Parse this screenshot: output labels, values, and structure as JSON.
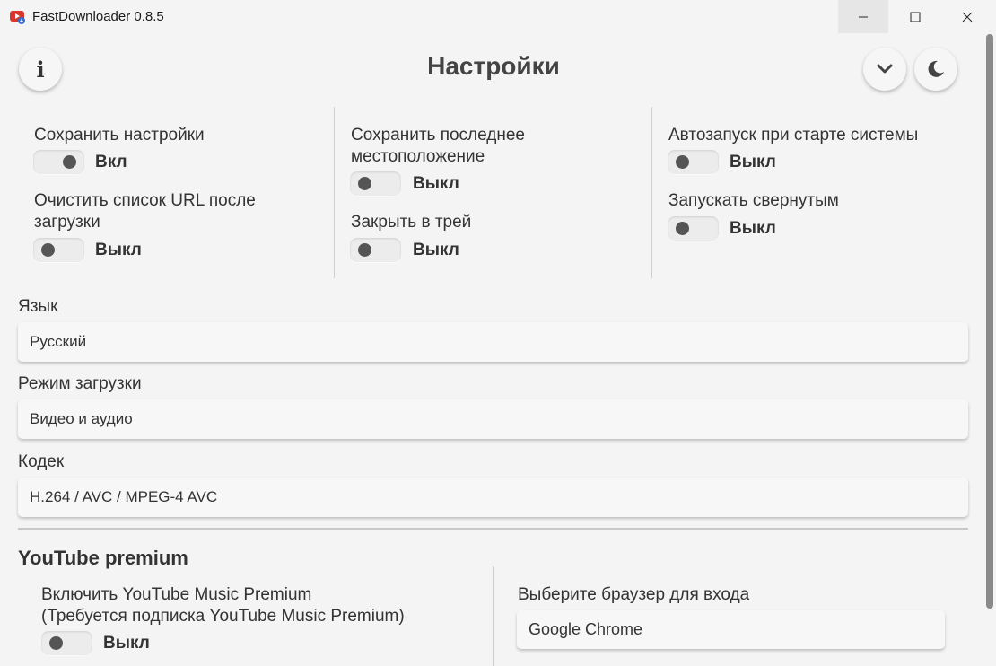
{
  "window": {
    "title": "FastDownloader 0.8.5"
  },
  "header": {
    "title": "Настройки",
    "info_glyph": "i"
  },
  "settings": {
    "save_settings": {
      "label": "Сохранить настройки",
      "state": "Вкл",
      "on": true
    },
    "clear_urls": {
      "label_line1": "Очистить список URL после",
      "label_line2": "загрузки",
      "state": "Выкл",
      "on": false
    },
    "save_location": {
      "label_line1": "Сохранить последнее",
      "label_line2": "местоположение",
      "state": "Выкл",
      "on": false
    },
    "close_to_tray": {
      "label": "Закрыть в трей",
      "state": "Выкл",
      "on": false
    },
    "autostart": {
      "label": "Автозапуск при старте системы",
      "state": "Выкл",
      "on": false
    },
    "start_minimized": {
      "label": "Запускать свернутым",
      "state": "Выкл",
      "on": false
    }
  },
  "fields": {
    "language": {
      "label": "Язык",
      "value": "Русский"
    },
    "download_mode": {
      "label": "Режим загрузки",
      "value": "Видео и аудио"
    },
    "codec": {
      "label": "Кодек",
      "value": "H.264 / AVC / MPEG-4 AVC"
    }
  },
  "youtube_premium": {
    "title": "YouTube premium",
    "enable_label_line1": "Включить YouTube Music Premium",
    "enable_label_line2": "(Требуется подписка YouTube Music Premium)",
    "enable_state": "Выкл",
    "enable_on": false,
    "browser_label": "Выберите браузер для входа",
    "browser_value": "Google Chrome"
  },
  "icons": [
    "app-logo-icon",
    "minimize-icon",
    "maximize-icon",
    "close-icon",
    "info-icon",
    "chevron-down-icon",
    "moon-icon"
  ]
}
